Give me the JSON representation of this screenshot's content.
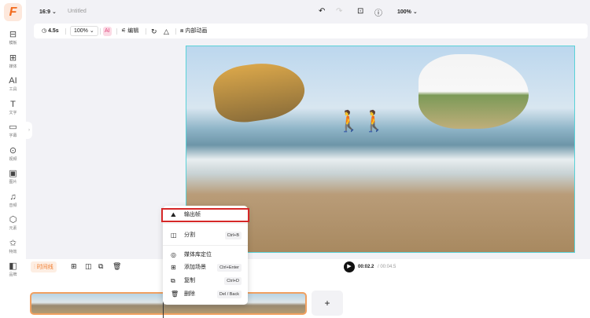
{
  "app": {
    "logo": "F",
    "aspect": "16:9",
    "title": "Untitled",
    "zoom": "100%"
  },
  "sidebar": [
    {
      "label": "模板",
      "icon": "template-icon",
      "g": "⊟"
    },
    {
      "label": "媒体",
      "icon": "media-icon",
      "g": "⊞"
    },
    {
      "label": "工具",
      "icon": "ai-tools-icon",
      "g": "AI"
    },
    {
      "label": "文字",
      "icon": "text-icon",
      "g": "T"
    },
    {
      "label": "字幕",
      "icon": "subtitle-icon",
      "g": "▭"
    },
    {
      "label": "视频",
      "icon": "video-icon",
      "g": "⊙"
    },
    {
      "label": "图片",
      "icon": "image-icon",
      "g": "▣"
    },
    {
      "label": "音频",
      "icon": "music-icon",
      "g": "♫"
    },
    {
      "label": "元素",
      "icon": "elements-icon",
      "g": "⬡"
    },
    {
      "label": "特效",
      "icon": "effects-icon",
      "g": "✩"
    },
    {
      "label": "品牌",
      "icon": "brand-icon",
      "g": "◧"
    }
  ],
  "toolbar": {
    "duration": "4.5s",
    "scale": "100%",
    "ai": "AI",
    "edit": "编辑",
    "animation": "内部动画"
  },
  "player": {
    "current": "00:02.2",
    "total": "/ 00:04.5"
  },
  "timeline": {
    "tab": "时间线",
    "add": "+"
  },
  "menu": [
    {
      "label": "输出帧",
      "icon": "export-frame-icon",
      "g": "⛰",
      "shortcut": ""
    },
    {
      "label": "分割",
      "icon": "split-icon",
      "g": "◫",
      "shortcut": "Ctrl+B"
    },
    {
      "label": "媒体库定位",
      "icon": "locate-icon",
      "g": "◎",
      "shortcut": ""
    },
    {
      "label": "添加场景",
      "icon": "add-scene-icon",
      "g": "⊞",
      "shortcut": "Ctrl+Enter"
    },
    {
      "label": "复制",
      "icon": "copy-icon",
      "g": "⧉",
      "shortcut": "Ctrl+D"
    },
    {
      "label": "删除",
      "icon": "trash-icon",
      "g": "🗑",
      "shortcut": "Del / Back"
    }
  ]
}
